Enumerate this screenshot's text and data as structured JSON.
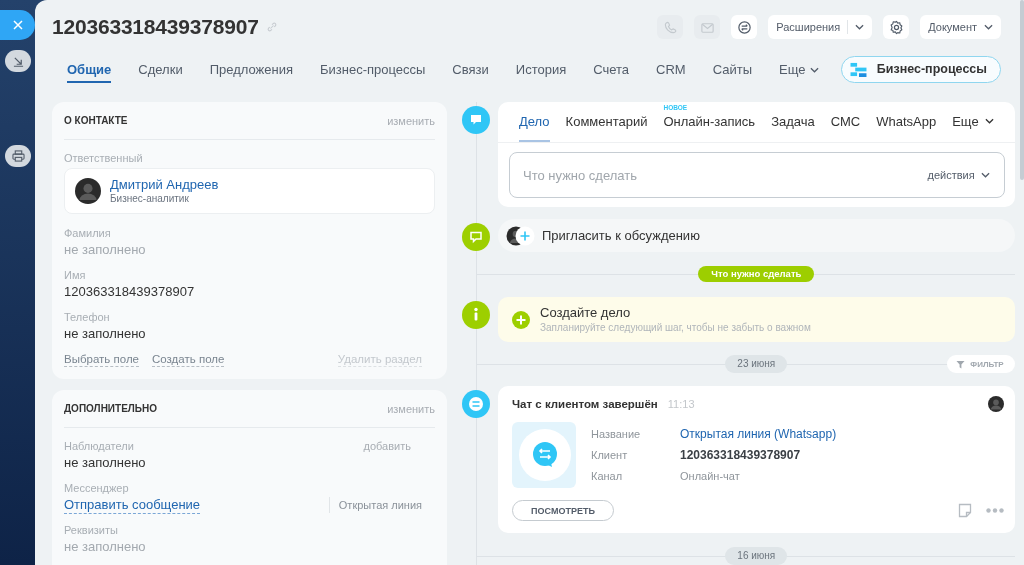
{
  "sidebar": {
    "buttons": [
      {
        "kind": "close"
      },
      {
        "kind": "minimize"
      },
      {
        "kind": "print"
      }
    ]
  },
  "header": {
    "title": "120363318439378907",
    "toolbar": [
      {
        "kind": "phone",
        "disabled": true
      },
      {
        "kind": "mail",
        "disabled": true
      },
      {
        "kind": "chat",
        "disabled": false
      },
      {
        "kind": "split",
        "label": "Расширения",
        "disabled": false
      },
      {
        "kind": "settings",
        "disabled": false
      },
      {
        "kind": "dropdown",
        "label": "Документ",
        "disabled": false
      }
    ]
  },
  "tabs": [
    {
      "kind": "tab",
      "label": "Общие",
      "selected": true
    },
    {
      "kind": "tab",
      "label": "Сделки",
      "selected": false
    },
    {
      "kind": "tab",
      "label": "Предложения",
      "selected": false
    },
    {
      "kind": "tab",
      "label": "Бизнес-процессы",
      "selected": false
    },
    {
      "kind": "tab",
      "label": "Связи",
      "selected": false
    },
    {
      "kind": "tab",
      "label": "История",
      "selected": false
    },
    {
      "kind": "tab",
      "label": "Счета",
      "selected": false
    },
    {
      "kind": "tab",
      "label": "CRM",
      "selected": false
    },
    {
      "kind": "tab",
      "label": "Сайты",
      "selected": false
    },
    {
      "kind": "more",
      "label": "Еще",
      "selected": false
    }
  ],
  "process_button": {
    "label": "Бизнес-процессы"
  },
  "sections": [
    {
      "title": "О КОНТАКТЕ",
      "action": "изменить",
      "fields": [
        {
          "kind": "user",
          "label": "Ответственный",
          "name": "Дмитрий Андреев",
          "role": "Бизнес-аналитик"
        },
        {
          "kind": "text",
          "label": "Фамилия",
          "value": "не заполнено",
          "muted": true
        },
        {
          "kind": "text",
          "label": "Имя",
          "value": "120363318439378907",
          "muted": false
        },
        {
          "kind": "text",
          "label": "Телефон",
          "value": "не заполнено",
          "muted": false
        }
      ],
      "footer": [
        {
          "label": "Выбрать поле",
          "disabled": false
        },
        {
          "label": "Создать поле",
          "disabled": false
        },
        {
          "label": "Удалить раздел",
          "disabled": true
        }
      ]
    },
    {
      "title": "ДОПОЛНИТЕЛЬНО",
      "action": "изменить",
      "fields": [
        {
          "kind": "text",
          "label": "Наблюдатели",
          "value": "не заполнено",
          "muted": false,
          "action": "добавить"
        },
        {
          "kind": "link",
          "label": "Мессенджер",
          "value": "Отправить сообщение",
          "extra": "Открытая линия"
        },
        {
          "kind": "text",
          "label": "Реквизиты",
          "value": "не заполнено",
          "muted": true
        }
      ]
    }
  ],
  "timeline": [
    {
      "kind": "composer",
      "tabs": [
        {
          "kind": "tab",
          "label": "Дело",
          "selected": true
        },
        {
          "kind": "tab",
          "label": "Комментарий",
          "selected": false
        },
        {
          "kind": "tab",
          "label": "Онлайн-запись",
          "selected": false,
          "badge": "НОВОЕ"
        },
        {
          "kind": "tab",
          "label": "Задача",
          "selected": false
        },
        {
          "kind": "tab",
          "label": "СМС",
          "selected": false
        },
        {
          "kind": "tab",
          "label": "WhatsApp",
          "selected": false
        },
        {
          "kind": "more",
          "label": "Еще",
          "selected": false
        }
      ],
      "placeholder": "Что нужно сделать",
      "actions": "действия"
    },
    {
      "kind": "invite",
      "label": "Пригласить к обсуждению"
    },
    {
      "kind": "divider",
      "label": "Что нужно сделать"
    },
    {
      "kind": "todo",
      "title": "Создайте дело",
      "subtitle": "Запланируйте следующий шаг, чтобы не забыть о важном"
    },
    {
      "kind": "date",
      "label": "23 июня",
      "filter": "ФИЛЬТР"
    },
    {
      "kind": "event",
      "title": "Чат с клиентом завершён",
      "time": "11:13",
      "rows": [
        {
          "kind": "link",
          "label": "Название",
          "value": "Открытая линия (Whatsapp)"
        },
        {
          "kind": "strong",
          "label": "Клиент",
          "value": "120363318439378907"
        },
        {
          "kind": "plain",
          "label": "Канал",
          "value": "Онлайн-чат"
        }
      ],
      "button": "ПОСМОТРЕТЬ"
    },
    {
      "kind": "date",
      "label": "16 июня"
    }
  ]
}
